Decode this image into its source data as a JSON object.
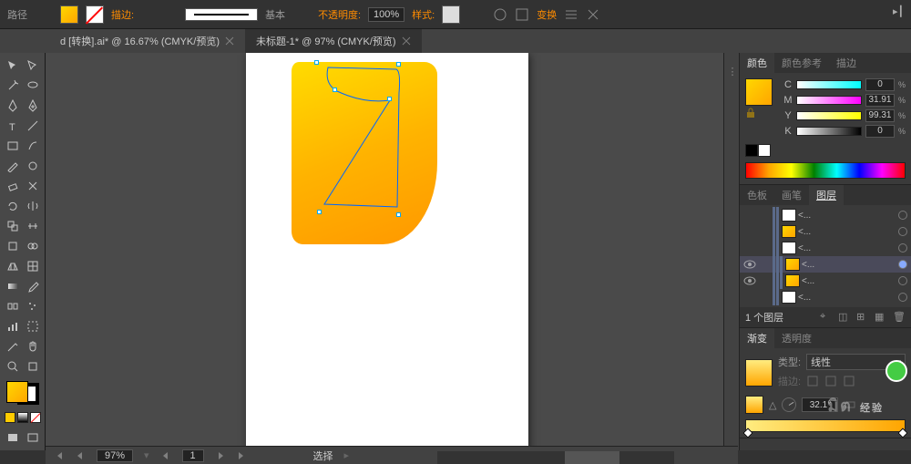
{
  "top": {
    "mode_label": "路径",
    "stroke_label": "描边:",
    "stroke_style": "基本",
    "opacity_label": "不透明度:",
    "opacity_value": "100%",
    "style_label": "样式:",
    "transform_label": "变换"
  },
  "tabs": [
    {
      "label": "d [转换].ai* @ 16.67% (CMYK/预览)",
      "active": false
    },
    {
      "label": "未标题-1* @ 97% (CMYK/预览)",
      "active": true
    }
  ],
  "color_panel": {
    "tabs": [
      "颜色",
      "颜色参考",
      "描边"
    ],
    "sliders": [
      {
        "ch": "C",
        "val": "0"
      },
      {
        "ch": "M",
        "val": "31.91"
      },
      {
        "ch": "Y",
        "val": "99.31"
      },
      {
        "ch": "K",
        "val": "0"
      }
    ]
  },
  "layers_panel": {
    "tabs": [
      "色板",
      "画笔",
      "图层"
    ],
    "rows": [
      {
        "name": "<...",
        "depth": 2,
        "thumb": "w",
        "eye": false,
        "sel": false
      },
      {
        "name": "<...",
        "depth": 2,
        "thumb": "y",
        "eye": false,
        "sel": false
      },
      {
        "name": "<...",
        "depth": 2,
        "thumb": "w",
        "eye": false,
        "sel": false
      },
      {
        "name": "<...",
        "depth": 3,
        "thumb": "y",
        "eye": true,
        "sel": true
      },
      {
        "name": "<...",
        "depth": 3,
        "thumb": "y",
        "eye": true,
        "sel": false
      },
      {
        "name": "<...",
        "depth": 2,
        "thumb": "w",
        "eye": false,
        "sel": false
      }
    ],
    "footer": "1 个图层"
  },
  "gradient_panel": {
    "tabs": [
      "渐变",
      "透明度"
    ],
    "type_label": "类型:",
    "type_value": "线性",
    "stroke_label": "描边:",
    "angle_label": "△",
    "angle_value": "32.1°"
  },
  "status": {
    "zoom": "97%",
    "doc_nav": "1",
    "tool": "选择"
  },
  "watermark": "经验"
}
